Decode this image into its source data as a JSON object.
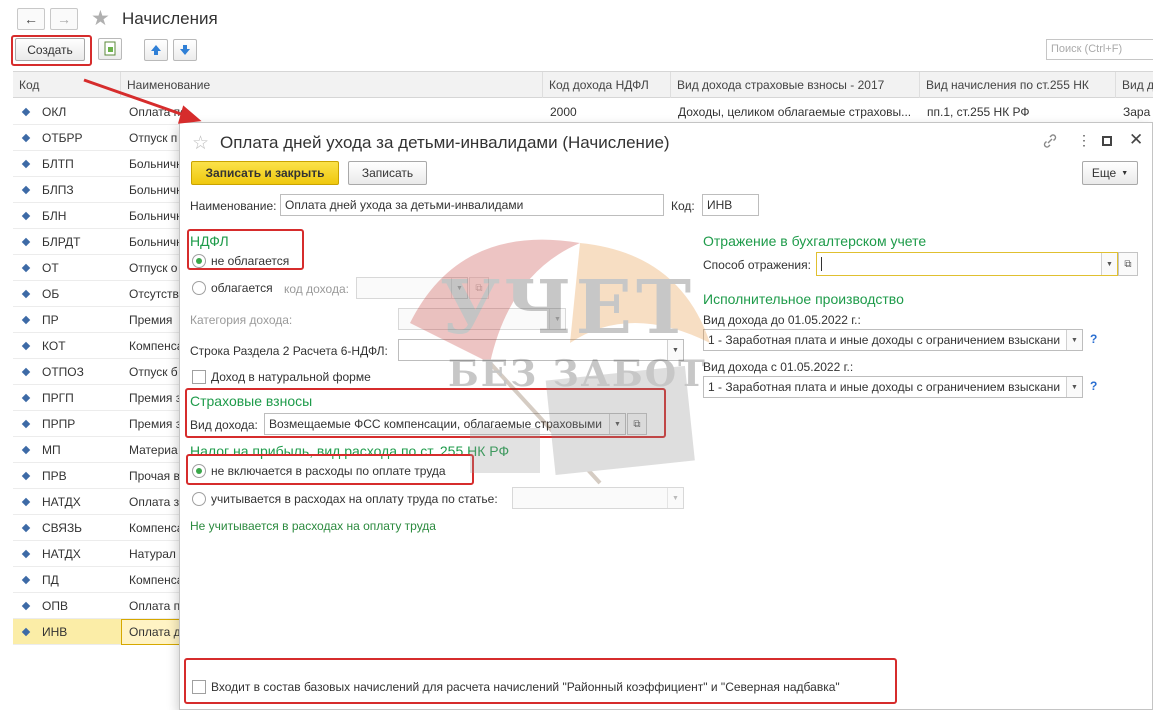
{
  "list_window": {
    "title": "Начисления",
    "create_label": "Создать",
    "search_placeholder": "Поиск (Ctrl+F)",
    "columns": [
      "Код",
      "Наименование",
      "Код дохода НДФЛ",
      "Вид дохода страховые взносы - 2017",
      "Вид начисления по ст.255 НК",
      "Вид д"
    ],
    "rows": [
      {
        "code": "ОКЛ",
        "name": "Оплата по окладу",
        "c3": "2000",
        "c4": "Доходы, целиком облагаемые страховы...",
        "c5": "пп.1, ст.255 НК РФ",
        "c6": "Зара"
      },
      {
        "code": "ОТБРР",
        "name": "Отпуск п"
      },
      {
        "code": "БЛТП",
        "name": "Больничн"
      },
      {
        "code": "БЛПЗ",
        "name": "Больничн"
      },
      {
        "code": "БЛН",
        "name": "Больничн"
      },
      {
        "code": "БЛРДТ",
        "name": "Больничн"
      },
      {
        "code": "ОТ",
        "name": "Отпуск о"
      },
      {
        "code": "ОБ",
        "name": "Отсутств"
      },
      {
        "code": "ПР",
        "name": "Премия"
      },
      {
        "code": "КОТ",
        "name": "Компенса"
      },
      {
        "code": "ОТПОЗ",
        "name": "Отпуск б"
      },
      {
        "code": "ПРГП",
        "name": "Премия з"
      },
      {
        "code": "ПРПР",
        "name": "Премия з"
      },
      {
        "code": "МП",
        "name": "Материа"
      },
      {
        "code": "ПРВ",
        "name": "Прочая в"
      },
      {
        "code": "НАТДХ",
        "name": "Оплата з"
      },
      {
        "code": "СВЯЗЬ",
        "name": "Компенса"
      },
      {
        "code": "НАТДХ",
        "name": "Натурал"
      },
      {
        "code": "ПД",
        "name": "Компенса"
      },
      {
        "code": "ОПВ",
        "name": "Оплата п"
      },
      {
        "code": "ИНВ",
        "name": "Оплата д",
        "selected": true
      }
    ]
  },
  "dialog": {
    "title": "Оплата дней ухода за детьми-инвалидами (Начисление)",
    "save_close_label": "Записать и закрыть",
    "save_label": "Записать",
    "more_label": "Еще",
    "name_label": "Наименование:",
    "name_value": "Оплата дней ухода за детьми-инвалидами",
    "code_label": "Код:",
    "code_value": "ИНВ",
    "ndfl": {
      "section": "НДФЛ",
      "opt_not_taxed": "не облагается",
      "opt_taxed": "облагается",
      "income_code_label": "код дохода:",
      "income_category_label": "Категория дохода:",
      "row_6ndfl_label": "Строка Раздела 2 Расчета 6-НДФЛ:",
      "natural_label": "Доход в натуральной форме"
    },
    "insurance": {
      "section": "Страховые взносы",
      "income_type_label": "Вид дохода:",
      "income_type_value": "Возмещаемые ФСС компенсации, облагаемые страховыми"
    },
    "profit_tax": {
      "section": "Налог на прибыль, вид расхода по ст. 255 НК РФ",
      "opt_not_included": "не включается в расходы по оплате труда",
      "opt_counted": "учитывается в расходах на оплату труда по статье:",
      "note": "Не учитывается в расходах на оплату труда"
    },
    "accounting": {
      "section": "Отражение в бухгалтерском учете",
      "method_label": "Способ отражения:"
    },
    "enforcement": {
      "section": "Исполнительное производство",
      "before_label": "Вид дохода до 01.05.2022 г.:",
      "before_value": "1 - Заработная плата и иные доходы с ограничением взыскани",
      "after_label": "Вид дохода с 01.05.2022 г.:",
      "after_value": "1 - Заработная плата и иные доходы с ограничением взыскани",
      "help": "?"
    },
    "base_accruals_label": "Входит в состав базовых начислений для расчета начислений \"Районный коэффициент\" и \"Северная надбавка\""
  },
  "watermark": {
    "line1": "УЧЕТ",
    "line2": "БЕЗ ЗАБОТ"
  },
  "colors": {
    "accent_green": "#1e9b4a",
    "highlight_red": "#d62c2c",
    "primary_button": "#f5d31c",
    "selection": "#fbeda7"
  }
}
